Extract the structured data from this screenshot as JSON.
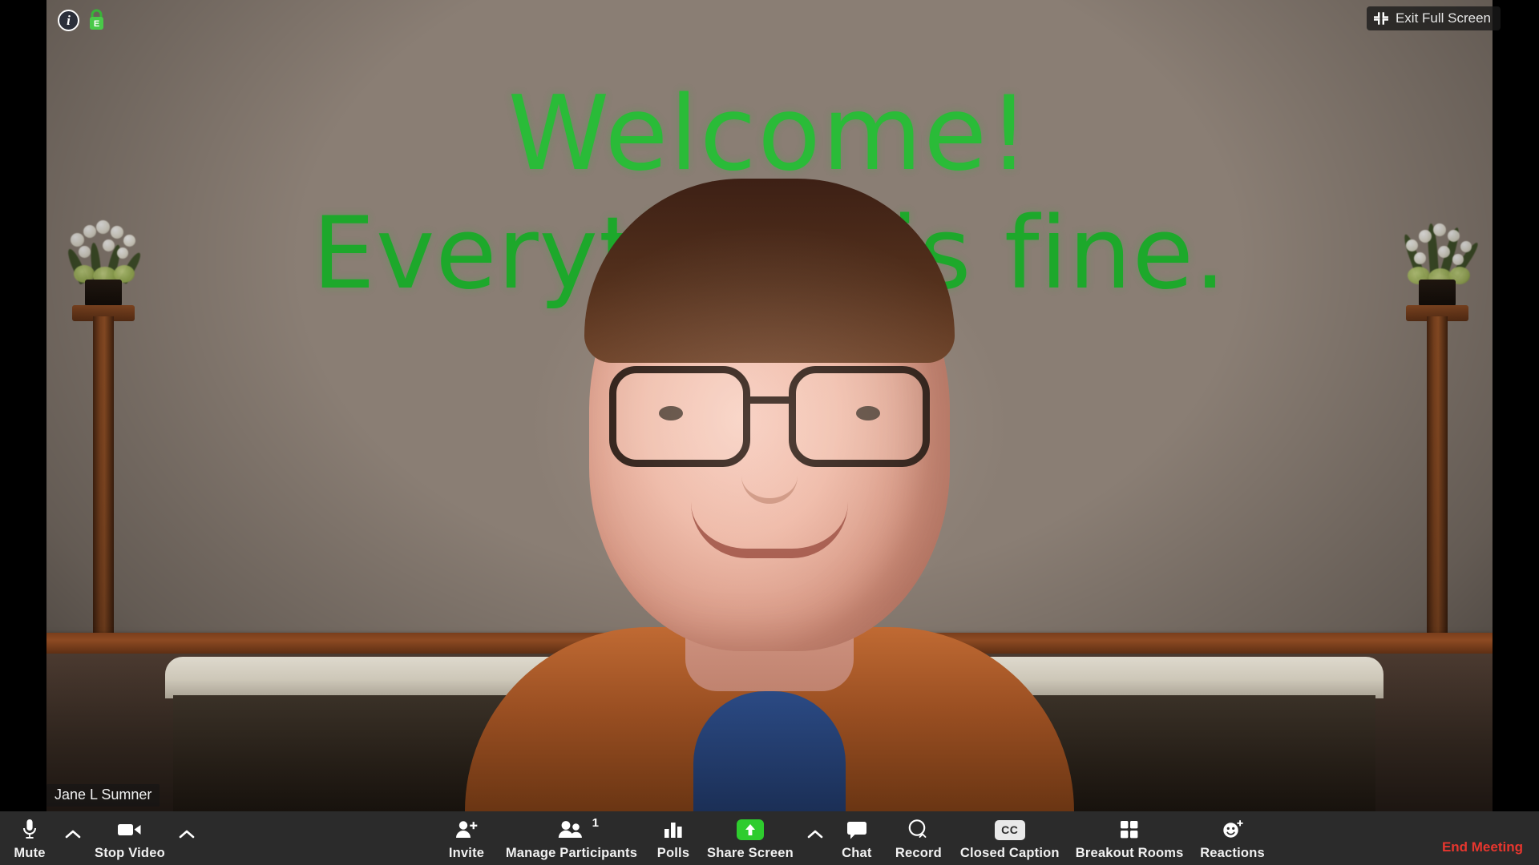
{
  "meeting": {
    "info_icon": "info-icon",
    "encryption_icon": "encrypted-lock-icon",
    "encryption_letter": "E",
    "info_letter": "i",
    "exit_full_screen_label": "Exit Full Screen",
    "exit_full_screen_icon": "collapse-arrows-icon"
  },
  "video": {
    "participant_name": "Jane L Sumner",
    "virtual_background": {
      "line1": "Welcome!",
      "line2": "Everything is fine.",
      "text_color": "#22bb33",
      "wall_color": "#8a7e74"
    }
  },
  "toolbar": {
    "background_color": "#2b2b2b",
    "left": [
      {
        "label": "Mute",
        "icon": "microphone-icon",
        "caret": true,
        "caret_icon": "chevron-up-icon"
      },
      {
        "label": "Stop Video",
        "icon": "video-camera-icon",
        "caret": true,
        "caret_icon": "chevron-up-icon"
      }
    ],
    "center": [
      {
        "label": "Invite",
        "icon": "add-person-icon",
        "badge": null,
        "caret": false
      },
      {
        "label": "Manage Participants",
        "icon": "people-icon",
        "badge": "1",
        "caret": false
      },
      {
        "label": "Polls",
        "icon": "bar-chart-icon",
        "badge": null,
        "caret": false
      },
      {
        "label": "Share Screen",
        "icon": "share-screen-up-arrow-icon",
        "badge": null,
        "caret": true,
        "caret_icon": "chevron-up-icon",
        "accent_color": "#2ecc2e"
      },
      {
        "label": "Chat",
        "icon": "chat-bubble-icon",
        "badge": null,
        "caret": false
      },
      {
        "label": "Record",
        "icon": "record-circle-icon",
        "badge": null,
        "caret": false
      },
      {
        "label": "Closed Caption",
        "icon": "cc-icon",
        "cc_text": "CC",
        "badge": null,
        "caret": false
      },
      {
        "label": "Breakout Rooms",
        "icon": "grid-squares-icon",
        "badge": null,
        "caret": false
      },
      {
        "label": "Reactions",
        "icon": "smiley-plus-icon",
        "badge": null,
        "caret": false
      }
    ],
    "right": {
      "end_meeting_label": "End Meeting",
      "end_meeting_color": "#e8362e"
    }
  }
}
